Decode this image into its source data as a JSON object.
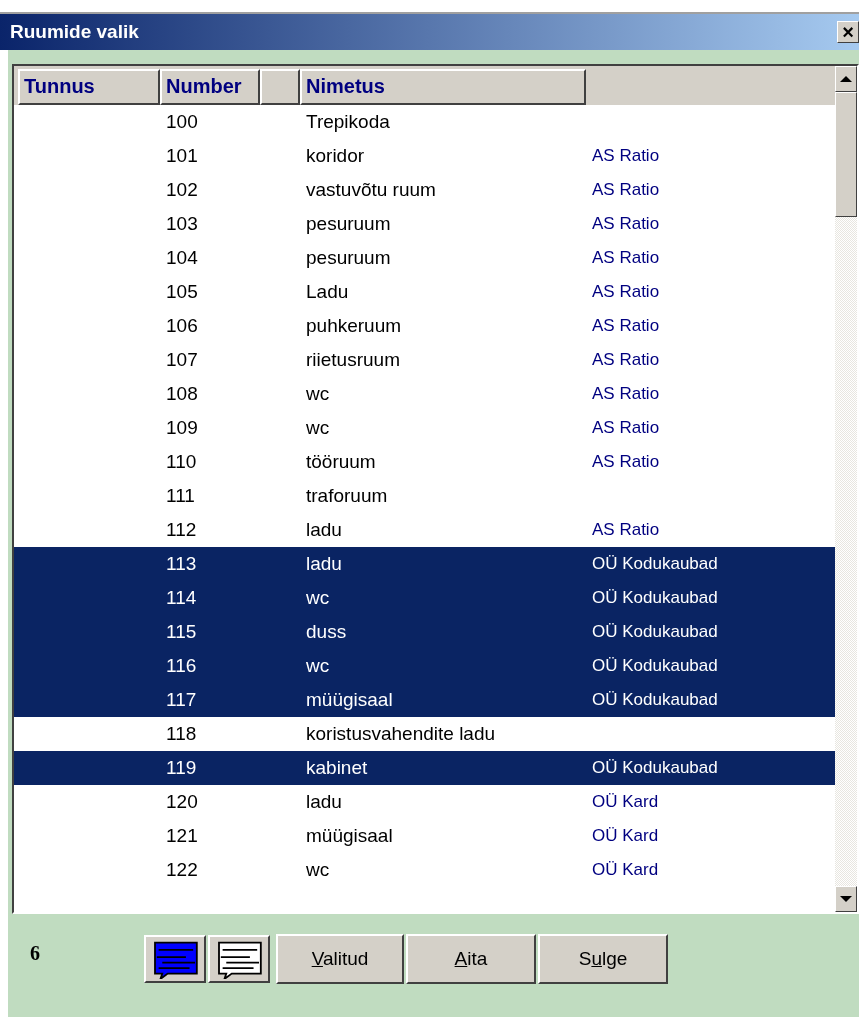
{
  "window": {
    "title": "Ruumide valik",
    "close": "×"
  },
  "table": {
    "columns": [
      "Tunnus",
      "Number",
      null,
      "Nimetus",
      null
    ],
    "rows": [
      {
        "number": "100",
        "name": "Trepikoda",
        "selected": false
      },
      {
        "number": "101",
        "name": "koridor",
        "owner": "AS Ratio",
        "selected": false
      },
      {
        "number": "102",
        "name": "vastuvõtu ruum",
        "owner": "AS Ratio",
        "selected": false
      },
      {
        "number": "103",
        "name": "pesuruum",
        "owner": "AS Ratio",
        "selected": false
      },
      {
        "number": "104",
        "name": "pesuruum",
        "owner": "AS Ratio",
        "selected": false
      },
      {
        "number": "105",
        "name": "Ladu",
        "owner": "AS Ratio",
        "selected": false
      },
      {
        "number": "106",
        "name": "puhkeruum",
        "owner": "AS Ratio",
        "selected": false
      },
      {
        "number": "107",
        "name": "riietusruum",
        "owner": "AS Ratio",
        "selected": false
      },
      {
        "number": "108",
        "name": "wc",
        "owner": "AS Ratio",
        "selected": false
      },
      {
        "number": "109",
        "name": "wc",
        "owner": "AS Ratio",
        "selected": false
      },
      {
        "number": "110",
        "name": "tööruum",
        "owner": "AS Ratio",
        "selected": false
      },
      {
        "number": "111",
        "name": "traforuum",
        "selected": false
      },
      {
        "number": "112",
        "name": "ladu",
        "owner": "AS Ratio",
        "selected": false
      },
      {
        "number": "113",
        "name": "ladu",
        "owner": "OÜ Kodukaubad",
        "selected": true
      },
      {
        "number": "114",
        "name": "wc",
        "owner": "OÜ Kodukaubad",
        "selected": true
      },
      {
        "number": "115",
        "name": "duss",
        "owner": "OÜ Kodukaubad",
        "selected": true
      },
      {
        "number": "116",
        "name": "wc",
        "owner": "OÜ Kodukaubad",
        "selected": true
      },
      {
        "number": "117",
        "name": "müügisaal",
        "owner": "OÜ Kodukaubad",
        "selected": true
      },
      {
        "number": "118",
        "name": "koristusvahendite ladu",
        "selected": false
      },
      {
        "number": "119",
        "name": "kabinet",
        "owner": "OÜ Kodukaubad",
        "selected": true
      },
      {
        "number": "120",
        "name": "ladu",
        "owner": "OÜ Kard",
        "selected": false
      },
      {
        "number": "121",
        "name": "müügisaal",
        "owner": "OÜ Kard",
        "selected": false
      },
      {
        "number": "122",
        "name": "wc",
        "owner": "OÜ Kard",
        "selected": false
      }
    ]
  },
  "footer": {
    "count": "6",
    "buttons": [
      {
        "key": "V",
        "after": "alitud"
      },
      {
        "key": "A",
        "after": "ita"
      },
      {
        "before": "S",
        "key": "u",
        "after": "lge"
      }
    ]
  }
}
